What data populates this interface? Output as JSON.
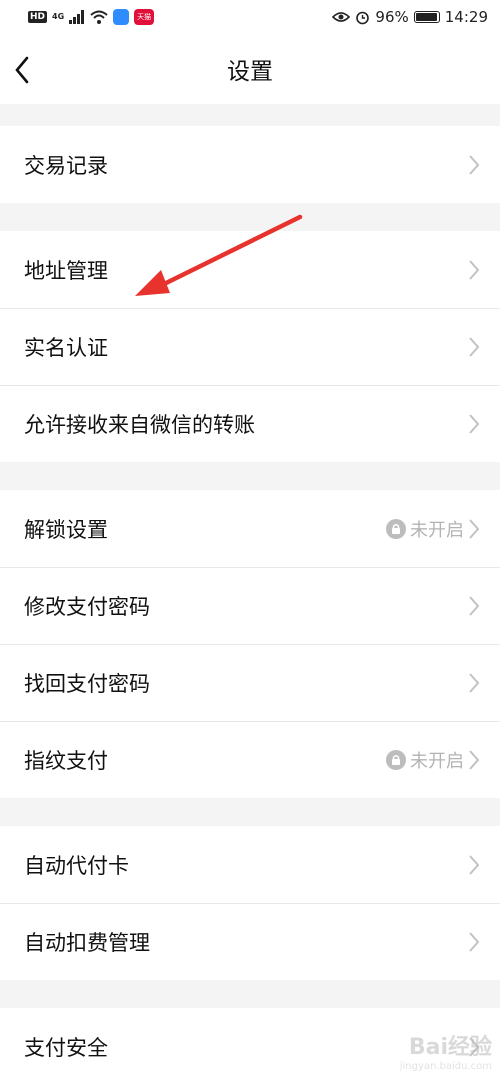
{
  "status_bar": {
    "hd": "HD",
    "network": "4G",
    "tmall": "天猫",
    "battery_percent": "96%",
    "time": "14:29"
  },
  "nav": {
    "title": "设置"
  },
  "groups": [
    {
      "items": [
        {
          "label": "交易记录"
        }
      ]
    },
    {
      "items": [
        {
          "label": "地址管理"
        },
        {
          "label": "实名认证"
        },
        {
          "label": "允许接收来自微信的转账"
        }
      ]
    },
    {
      "items": [
        {
          "label": "解锁设置",
          "status": "未开启"
        },
        {
          "label": "修改支付密码"
        },
        {
          "label": "找回支付密码"
        },
        {
          "label": "指纹支付",
          "status": "未开启"
        }
      ]
    },
    {
      "items": [
        {
          "label": "自动代付卡"
        },
        {
          "label": "自动扣费管理"
        }
      ]
    },
    {
      "items": [
        {
          "label": "支付安全"
        }
      ]
    }
  ],
  "annotation": {
    "arrow_color": "#e8322e"
  },
  "watermark": {
    "text": "Bai经验",
    "sub": "jingyan.baidu.com"
  }
}
